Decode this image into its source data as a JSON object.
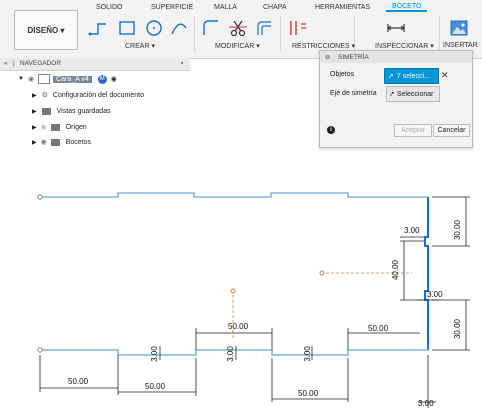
{
  "toolbar": {
    "workspace_label": "DISEÑO ▾",
    "tabs": [
      "SOLIDO",
      "SUPERFICIE",
      "MALLA",
      "CHAPA",
      "HERRAMIENTAS",
      "BOCETO"
    ],
    "groups": [
      "CREAR ▾",
      "MODIFICAR ▾",
      "RESTRICCIONES ▾",
      "INSPECCIONAR ▾",
      "INSERTAR ▾"
    ]
  },
  "navigator": {
    "title": "NAVEGADOR",
    "items": [
      {
        "label": "Cara_A v4"
      },
      {
        "label": "Configuración del documento"
      },
      {
        "label": "Vistas guardadas"
      },
      {
        "label": "Origen"
      },
      {
        "label": "Bocetos"
      }
    ]
  },
  "dialog": {
    "title": "SIMETRÍA",
    "objects_label": "Objetos",
    "objects_value": "7 selecci...",
    "axis_label": "Eje de simetría",
    "axis_button": "Seleccionar",
    "ok_label": "Aceptar",
    "cancel_label": "Cancelar",
    "clear_icon": "close-icon",
    "info_icon": "info-icon"
  },
  "sketch": {
    "dimensions": {
      "d1": "3.00",
      "d2": "30.00",
      "d3": "40.00",
      "d4": "3.00",
      "d5": "30.00",
      "d6": "50.00",
      "d7": "50.00",
      "d8": "3.00",
      "d9": "3.00",
      "d10": "3.00",
      "d11": "50.00",
      "d12": "50.00",
      "d13": "50.00",
      "d14": "3.00"
    }
  },
  "colors": {
    "accent": "#0696d7",
    "sketch_line": "#7fb7e3",
    "selected_line": "#1f6fd0",
    "dimension": "#111111"
  }
}
